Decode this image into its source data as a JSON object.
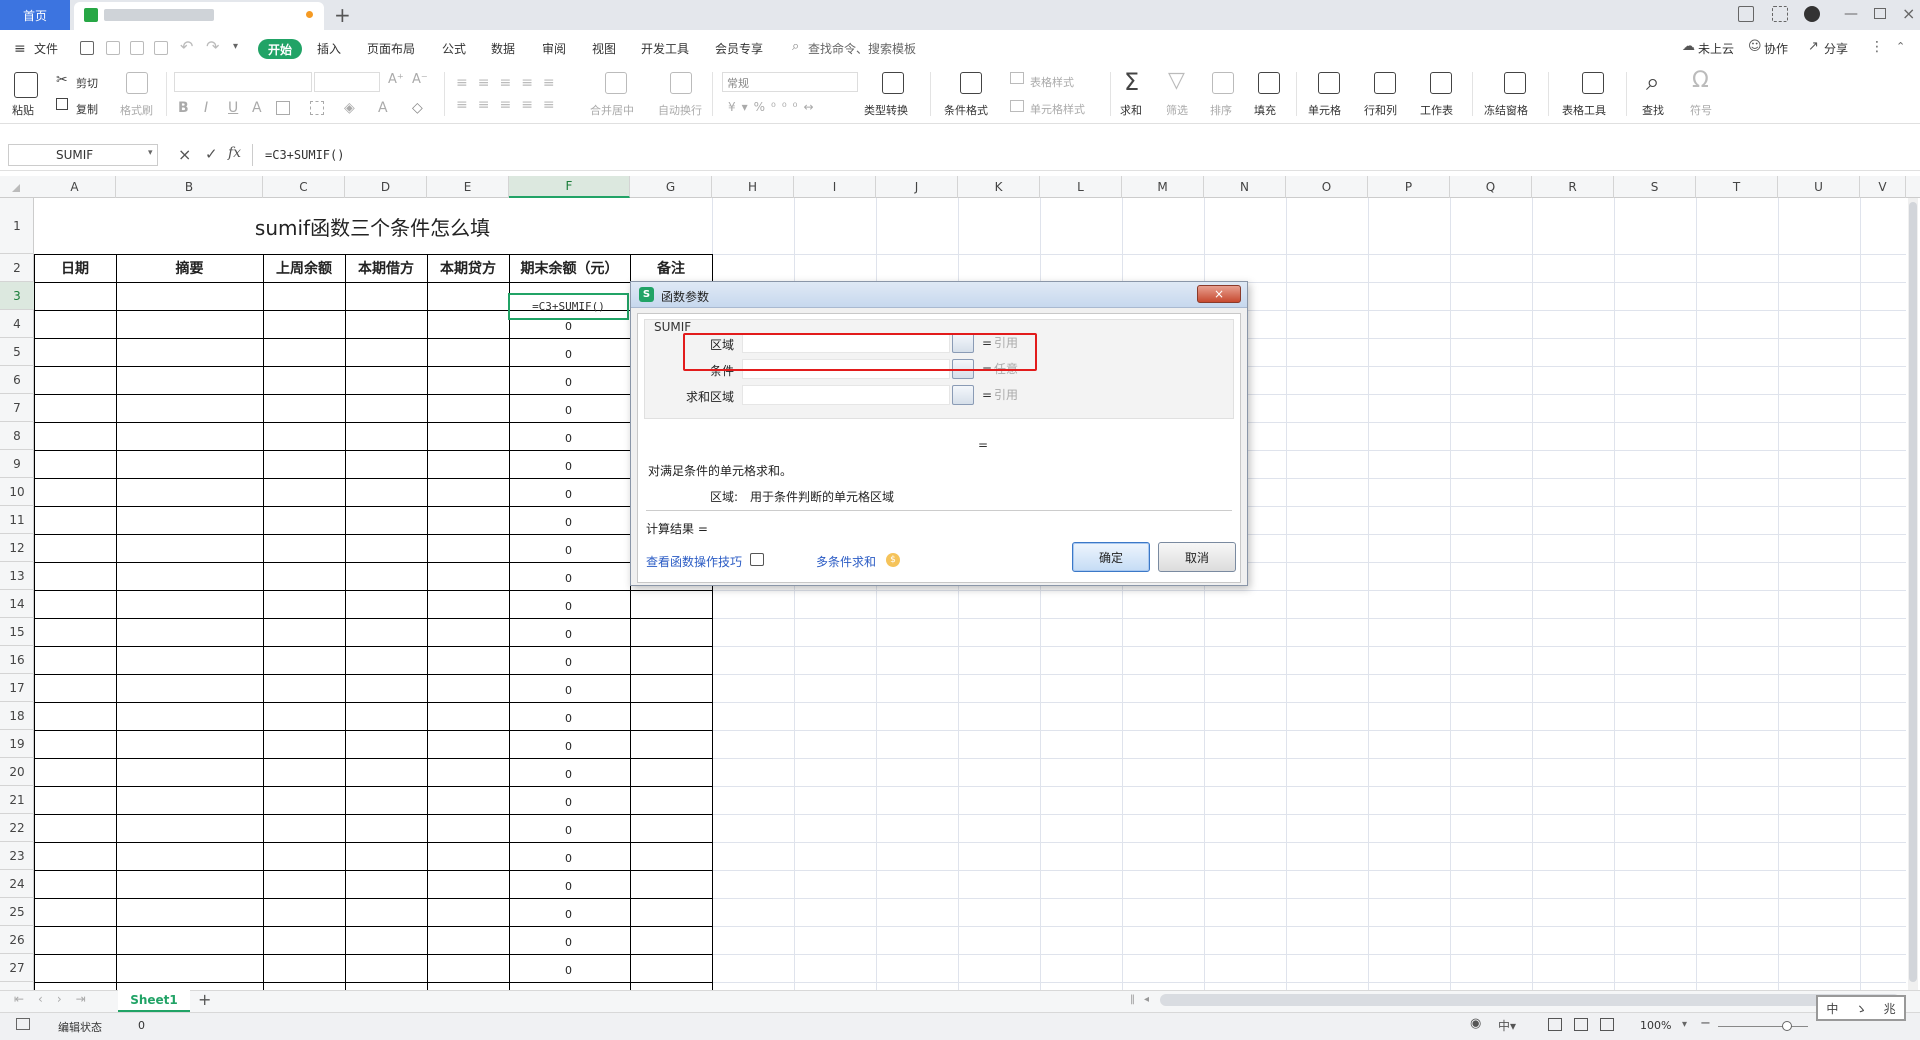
{
  "tabs": {
    "home": "首页"
  },
  "menu": {
    "file": "文件",
    "items": [
      "开始",
      "插入",
      "页面布局",
      "公式",
      "数据",
      "审阅",
      "视图",
      "开发工具",
      "会员专享"
    ],
    "search": "查找命令、搜索模板",
    "cloud": "未上云",
    "collab": "协作",
    "share": "分享"
  },
  "ribbon": {
    "paste": "粘贴",
    "cut": "剪切",
    "copy": "复制",
    "format_painter": "格式刷",
    "number_format": "常规",
    "merge": "合并居中",
    "wrap": "自动换行",
    "type_convert": "类型转换",
    "cond_format": "条件格式",
    "table_style": "表格样式",
    "cell_style": "单元格样式",
    "sum": "求和",
    "filter": "筛选",
    "sort": "排序",
    "fill": "填充",
    "cell": "单元格",
    "rowcol": "行和列",
    "worksheet": "工作表",
    "freeze": "冻结窗格",
    "table_tools": "表格工具",
    "find": "查找",
    "symbol": "符号"
  },
  "formula_bar": {
    "name_box": "SUMIF",
    "formula": "=C3+SUMIF()",
    "fx": "fx"
  },
  "columns": [
    "A",
    "B",
    "C",
    "D",
    "E",
    "F",
    "G",
    "H",
    "I",
    "J",
    "K",
    "L",
    "M",
    "N",
    "O",
    "P",
    "Q",
    "R",
    "S",
    "T",
    "U",
    "V"
  ],
  "rows": [
    "1",
    "2",
    "3",
    "4",
    "5",
    "6",
    "7",
    "8",
    "9",
    "10",
    "11",
    "12",
    "13",
    "14",
    "15",
    "16",
    "17",
    "18",
    "19",
    "20",
    "21",
    "22",
    "23",
    "24",
    "25",
    "26",
    "27"
  ],
  "sheet": {
    "title": "sumif函数三个条件怎么填",
    "headers": [
      "日期",
      "摘要",
      "上周余额",
      "本期借方",
      "本期贷方",
      "期末余额（元）",
      "备注"
    ],
    "f3": "=C3+SUMIF()",
    "f_values": [
      "0",
      "0",
      "0",
      "0",
      "0",
      "0",
      "0",
      "0",
      "0",
      "0",
      "0",
      "0",
      "0",
      "0",
      "0",
      "0",
      "0",
      "0",
      "0",
      "0",
      "0",
      "0",
      "0",
      "0"
    ]
  },
  "dialog": {
    "title": "函数参数",
    "close": "×",
    "func_name": "SUMIF",
    "args": [
      {
        "label": "区域",
        "type": "引用"
      },
      {
        "label": "条件",
        "type": "任意"
      },
      {
        "label": "求和区域",
        "type": "引用"
      }
    ],
    "eq": "=",
    "description": "对满足条件的单元格求和。",
    "arg_help_label": "区域:",
    "arg_help_text": "用于条件判断的单元格区域",
    "result_label": "计算结果 =",
    "tips_link": "查看函数操作技巧",
    "multi_link": "多条件求和",
    "ok": "确定",
    "cancel": "取消"
  },
  "sheet_tab": "Sheet1",
  "status": {
    "mode": "编辑状态",
    "value": "0",
    "zoom": "100%",
    "ime": [
      "中",
      "ゝ",
      "兆"
    ]
  }
}
